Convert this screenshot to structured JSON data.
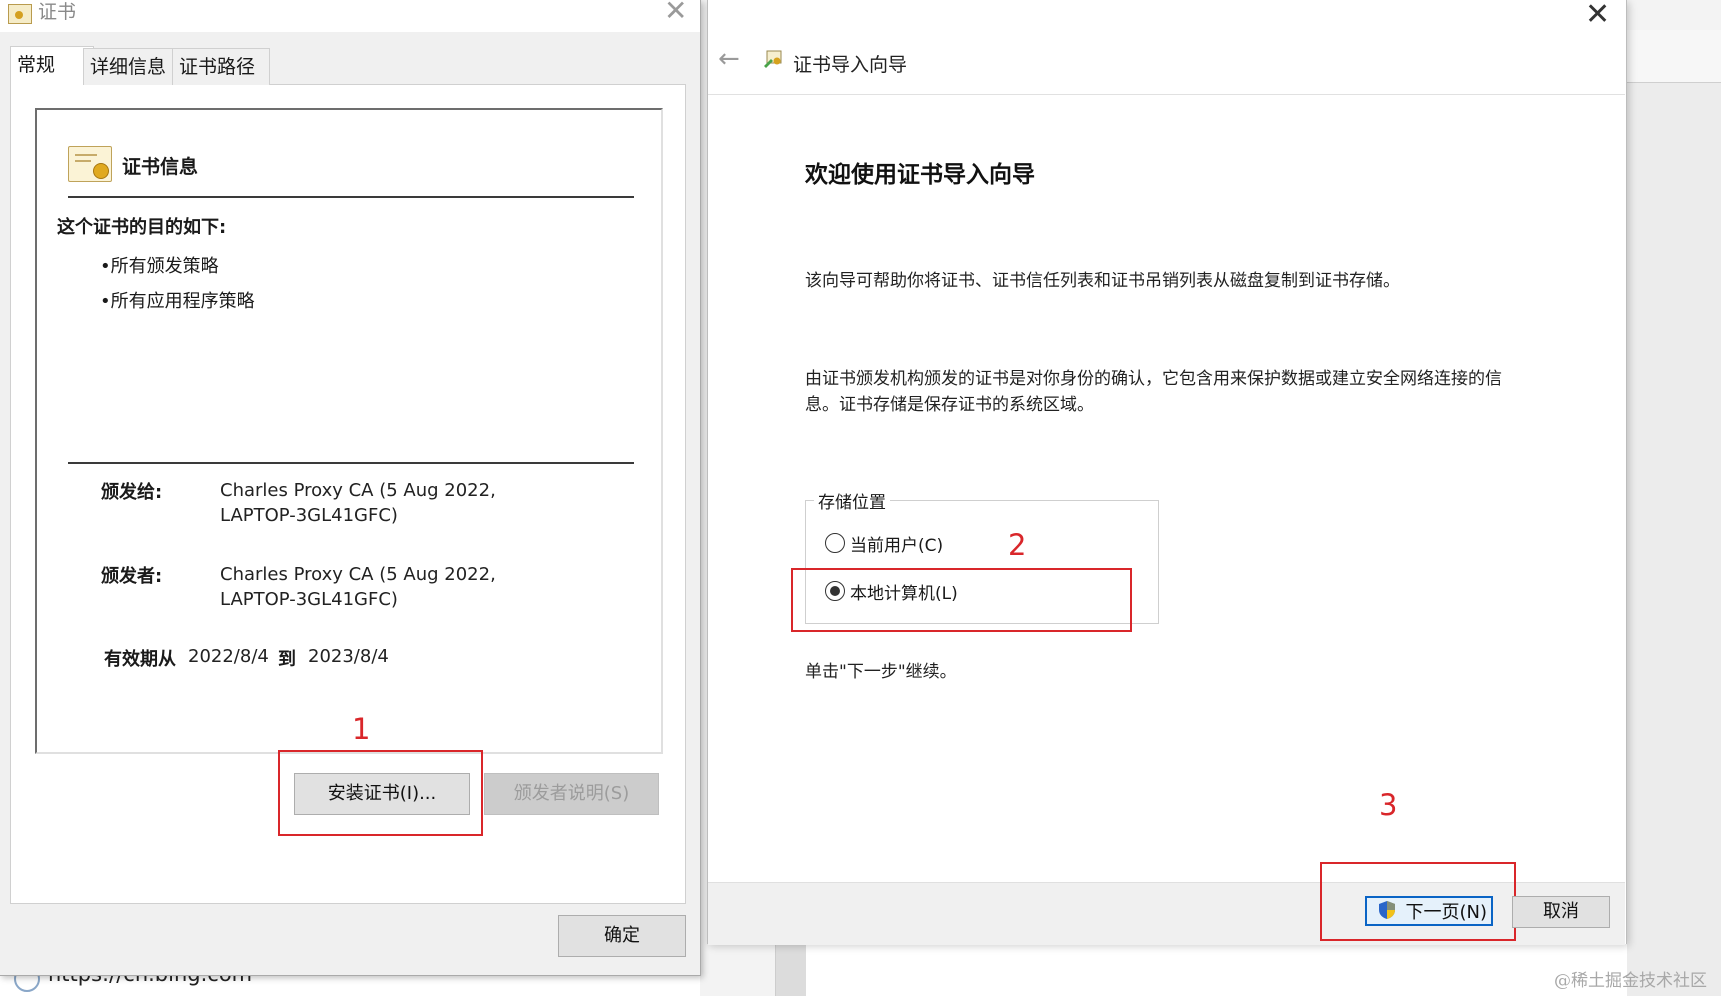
{
  "background": {
    "url_text": "https://cn.bing.com"
  },
  "cert_dialog": {
    "title": "证书",
    "close_glyph": "✕",
    "tabs": [
      "常规",
      "详细信息",
      "证书路径"
    ],
    "info_title": "证书信息",
    "purpose_heading": "这个证书的目的如下:",
    "purposes": [
      "•所有颁发策略",
      "•所有应用程序策略"
    ],
    "issued_to_label": "颁发给:",
    "issued_to_value_line1": "Charles Proxy CA (5 Aug 2022,",
    "issued_to_value_line2": "LAPTOP-3GL41GFC)",
    "issued_by_label": "颁发者:",
    "issued_by_value_line1": "Charles Proxy CA (5 Aug 2022,",
    "issued_by_value_line2": "LAPTOP-3GL41GFC)",
    "validity_label": "有效期从",
    "valid_from": "2022/8/4",
    "to_label": "到",
    "valid_to": "2023/8/4",
    "install_button": "安装证书(I)...",
    "issuer_statement_button": "颁发者说明(S)",
    "ok_button": "确定"
  },
  "wizard": {
    "close_glyph": "✕",
    "back_glyph": "←",
    "header": "证书导入向导",
    "title": "欢迎使用证书导入向导",
    "paragraph1": "该向导可帮助你将证书、证书信任列表和证书吊销列表从磁盘复制到证书存储。",
    "paragraph2_line1": "由证书颁发机构颁发的证书是对你身份的确认，它包含用来保护数据或建立安全网络连接的信",
    "paragraph2_line2": "息。证书存储是保存证书的系统区域。",
    "store_location_label": "存储位置",
    "option_current_user": "当前用户(C)",
    "option_local_machine": "本地计算机(L)",
    "selected_option": "本地计算机(L)",
    "continue_text": "单击\"下一步\"继续。",
    "next_button": "下一页(N)",
    "cancel_button": "取消"
  },
  "annotations": {
    "step1": "1",
    "step2": "2",
    "step3": "3"
  },
  "watermark": "@稀土掘金技术社区",
  "colors": {
    "annotation_red": "#d9262a",
    "primary_button_border": "#0a64c5"
  }
}
